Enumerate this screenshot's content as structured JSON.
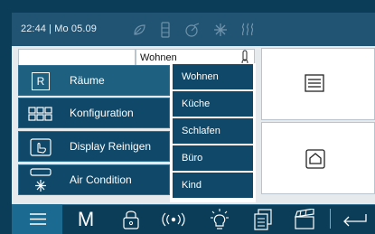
{
  "status_bar": {
    "datetime": "22:44 | Mo 05.09",
    "icons": [
      "leaf-icon",
      "window-icon",
      "shutter-icon",
      "snowflake-icon",
      "heat-icon"
    ]
  },
  "room_panel": {
    "title": "Wohnen"
  },
  "menu": {
    "items": [
      {
        "label": "Räume",
        "icon": "rooms-icon",
        "icon_text": "R",
        "active": true
      },
      {
        "label": "Konfiguration",
        "icon": "grid-icon"
      },
      {
        "label": "Display Reinigen",
        "icon": "hand-icon"
      },
      {
        "label": "Air Condition",
        "icon": "aircon-icon"
      }
    ]
  },
  "submenu": {
    "items": [
      "Wohnen",
      "Küche",
      "Schlafen",
      "Büro",
      "Kind"
    ]
  },
  "taskbar": {
    "menu_letter": "M",
    "icons": [
      "hamburger-icon",
      "m-icon",
      "lock-icon",
      "radio-icon",
      "bulb-icon",
      "document-icon",
      "scene-icon",
      "back-icon"
    ]
  },
  "colors": {
    "accent": "#0f4868",
    "statusbar": "#215372",
    "frame": "#0b3d59"
  }
}
